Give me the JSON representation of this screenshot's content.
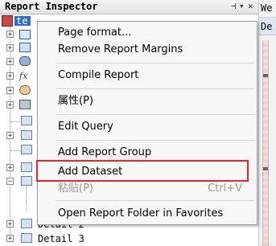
{
  "panel": {
    "title": "Report Inspector",
    "pin_glyph": "⊣",
    "dropdown_glyph": "▾",
    "close_glyph": "✕"
  },
  "right_panel": {
    "tab1_label": "We",
    "tab2_label": "De"
  },
  "tree": {
    "root_label": "te",
    "bottom_rows": [
      "Detail 2",
      "Detail 3"
    ]
  },
  "context_menu": {
    "items": [
      {
        "label": "Page format...",
        "enabled": true
      },
      {
        "label": "Remove Report Margins",
        "enabled": true
      },
      {
        "label": "Compile Report",
        "enabled": true
      },
      {
        "label": "属性(P)",
        "enabled": true
      },
      {
        "label": "Edit Query",
        "enabled": true
      },
      {
        "label": "Add Report Group",
        "enabled": true
      },
      {
        "label": "Add Dataset",
        "enabled": true,
        "highlighted": true
      },
      {
        "label": "粘贴(P)",
        "enabled": false,
        "shortcut": "Ctrl+V"
      },
      {
        "label": "Open Report Folder in Favorites",
        "enabled": true
      }
    ]
  },
  "colors": {
    "highlight_box": "#e3262f",
    "selection": "#316ac5"
  }
}
